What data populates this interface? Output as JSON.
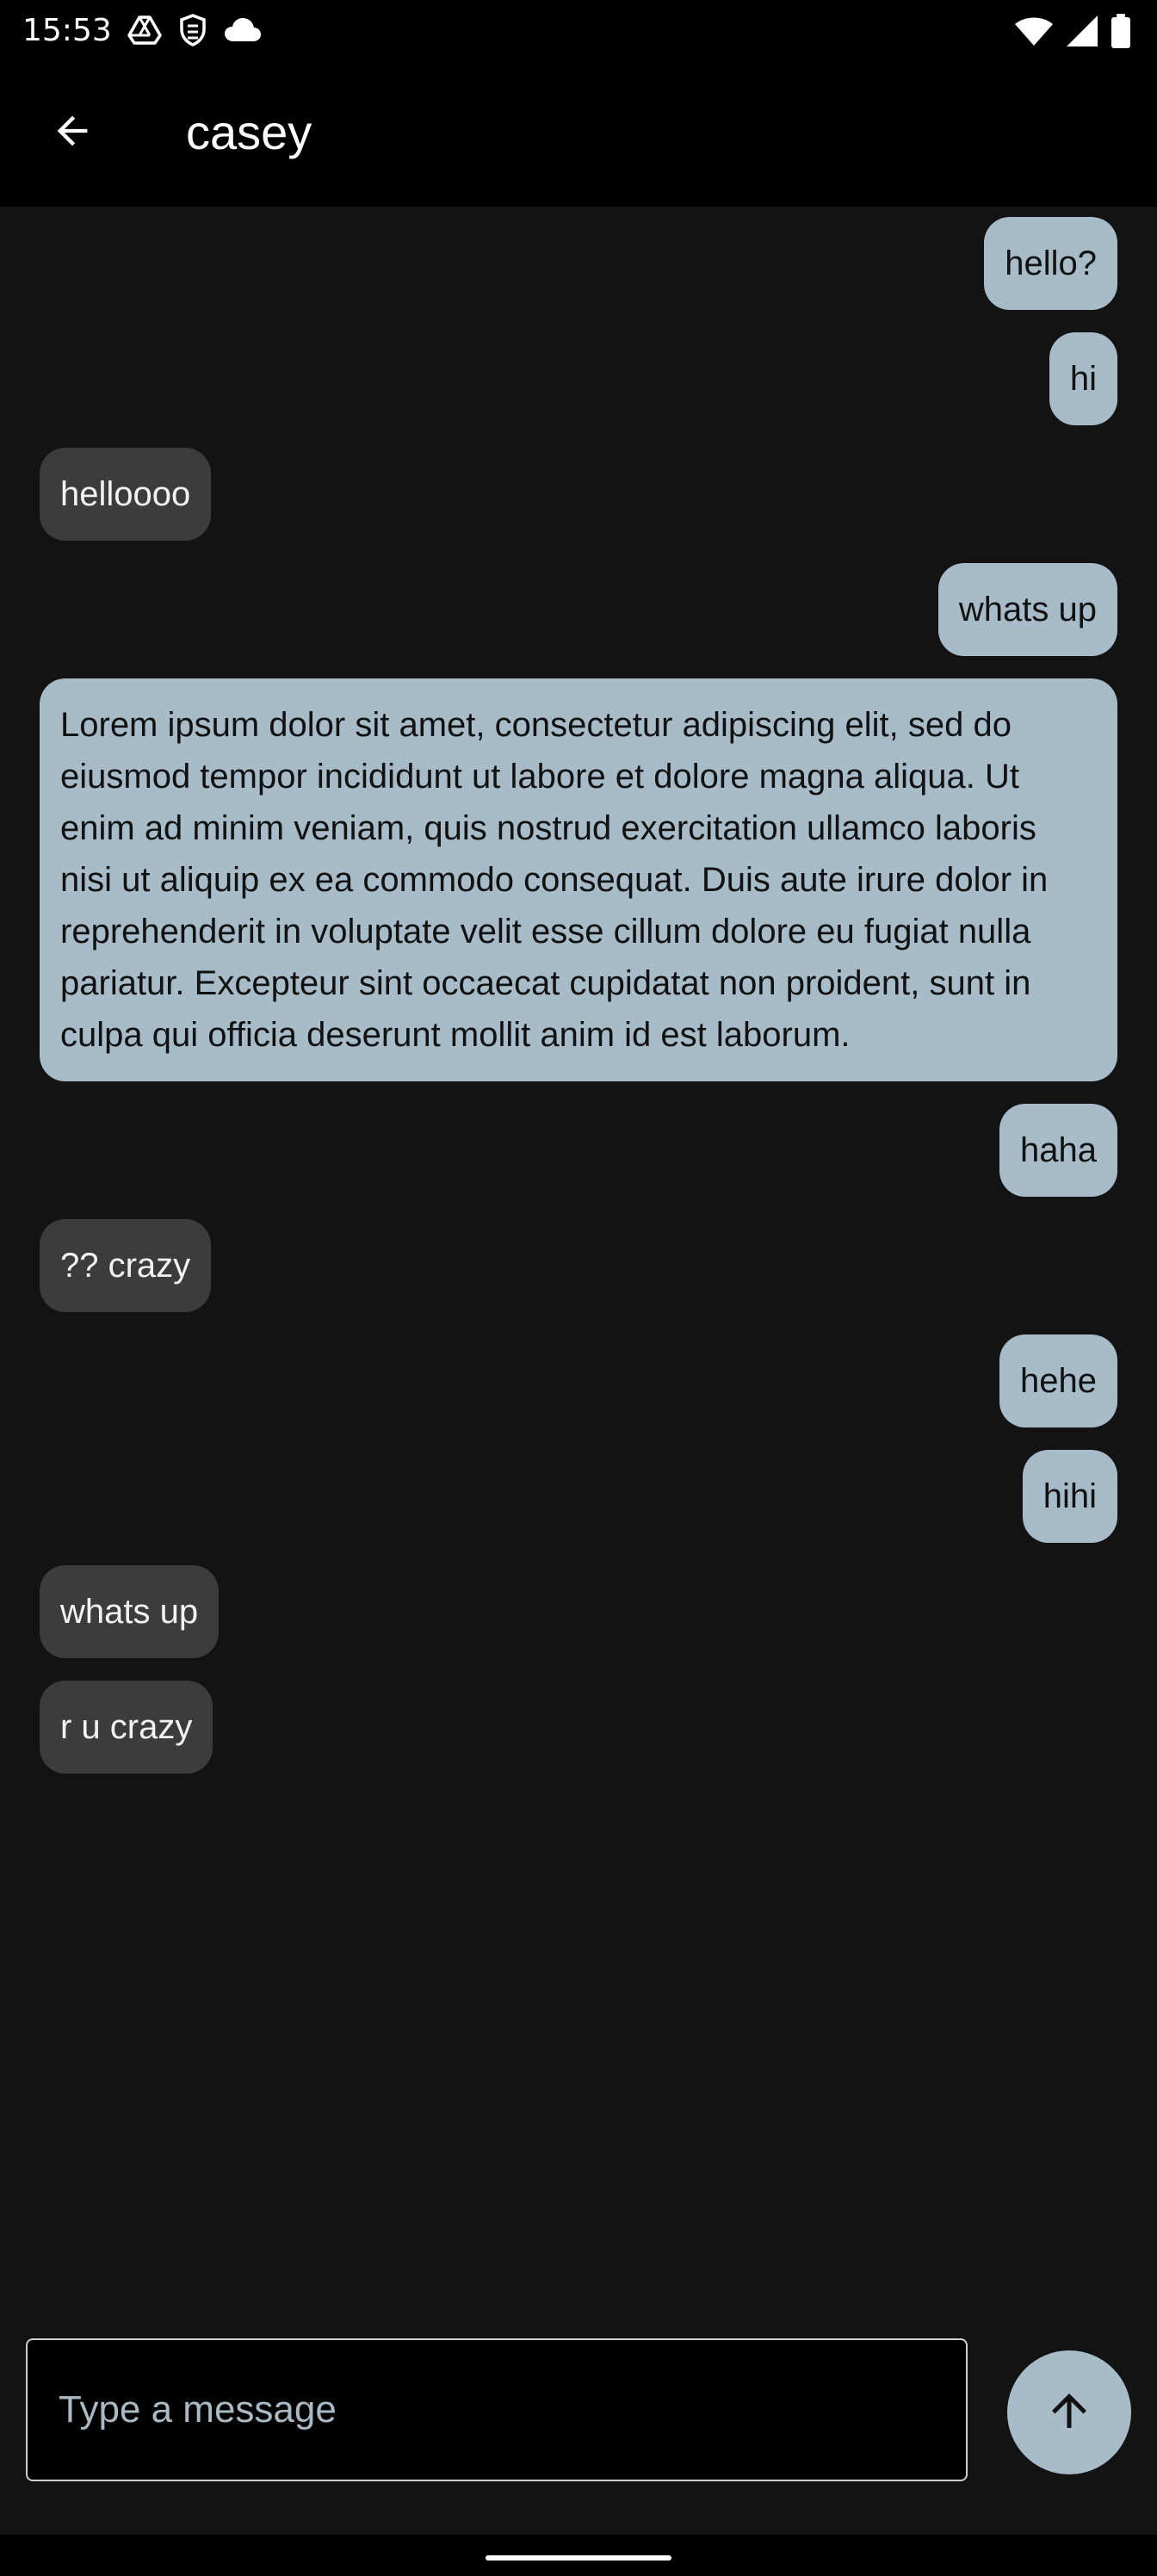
{
  "status_bar": {
    "time": "15:53",
    "left_icons": [
      "drive-icon",
      "shield-icon",
      "cloud-icon"
    ],
    "right_icons": [
      "wifi-icon",
      "cellular-signal-icon",
      "battery-icon"
    ]
  },
  "app_bar": {
    "back_icon": "arrow-back-icon",
    "title": "casey"
  },
  "messages": [
    {
      "direction": "sent",
      "text": "hello?"
    },
    {
      "direction": "sent",
      "text": "hi"
    },
    {
      "direction": "received",
      "text": "helloooo"
    },
    {
      "direction": "sent",
      "text": "whats up"
    },
    {
      "direction": "sent",
      "text": "Lorem ipsum dolor sit amet, consectetur adipiscing elit, sed do eiusmod tempor incididunt ut labore et dolore magna aliqua. Ut enim ad minim veniam, quis nostrud exercitation ullamco laboris nisi ut aliquip ex ea commodo consequat. Duis aute irure dolor in reprehenderit in voluptate velit esse cillum dolore eu fugiat nulla pariatur. Excepteur sint occaecat cupidatat non proident, sunt in culpa qui officia deserunt mollit anim id est laborum."
    },
    {
      "direction": "sent",
      "text": "haha"
    },
    {
      "direction": "received",
      "text": "?? crazy"
    },
    {
      "direction": "sent",
      "text": "hehe"
    },
    {
      "direction": "sent",
      "text": "hihi"
    },
    {
      "direction": "received",
      "text": "whats up"
    },
    {
      "direction": "received",
      "text": "r u crazy"
    }
  ],
  "composer": {
    "placeholder": "Type a message",
    "value": "",
    "send_icon": "arrow-upward-icon"
  },
  "colors": {
    "sent_bubble": "#a7bcc8",
    "received_bubble": "#3c3c3c",
    "background": "#131313",
    "bar_background": "#000000"
  }
}
